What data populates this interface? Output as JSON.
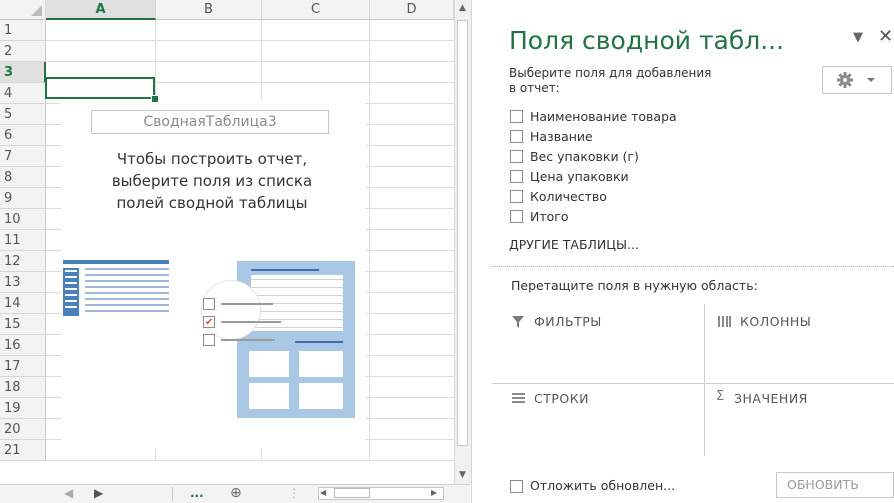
{
  "sheet": {
    "columns": [
      "A",
      "B",
      "C",
      "D"
    ],
    "rows": [
      "1",
      "2",
      "3",
      "4",
      "5",
      "6",
      "7",
      "8",
      "9",
      "10",
      "11",
      "12",
      "13",
      "14",
      "15",
      "16",
      "17",
      "18",
      "19",
      "20",
      "21"
    ],
    "selected_column": "A",
    "selected_row": "3",
    "pivot_name": "СводнаяТаблица3",
    "pivot_instructions": [
      "Чтобы построить отчет,",
      "выберите поля из списка",
      "полей сводной таблицы"
    ],
    "sheet_bar": {
      "ellipsis": "...",
      "add_sheet": "⊕"
    },
    "accent_color": "#217346"
  },
  "pane": {
    "title": "Поля сводной табл...",
    "choose_label_line1": "Выберите поля для добавления",
    "choose_label_line2": "в отчет:",
    "fields": [
      "Наименование товара",
      "Название",
      "Вес упаковки (г)",
      "Цена упаковки",
      "Количество",
      "Итого"
    ],
    "more_tables": "ДРУГИЕ ТАБЛИЦЫ...",
    "drag_label": "Перетащите поля в нужную область:",
    "areas": {
      "filters": "ФИЛЬТРЫ",
      "columns": "КОЛОННЫ",
      "rows": "СТРОКИ",
      "values": "ЗНАЧЕНИЯ"
    },
    "defer_label": "Отложить обновлен...",
    "update_button": "ОБНОВИТЬ",
    "icons": {
      "tools": "gear-icon",
      "filter": "filter-icon",
      "columns": "columns-icon",
      "rows": "rows-icon",
      "values": "sigma-icon"
    }
  }
}
